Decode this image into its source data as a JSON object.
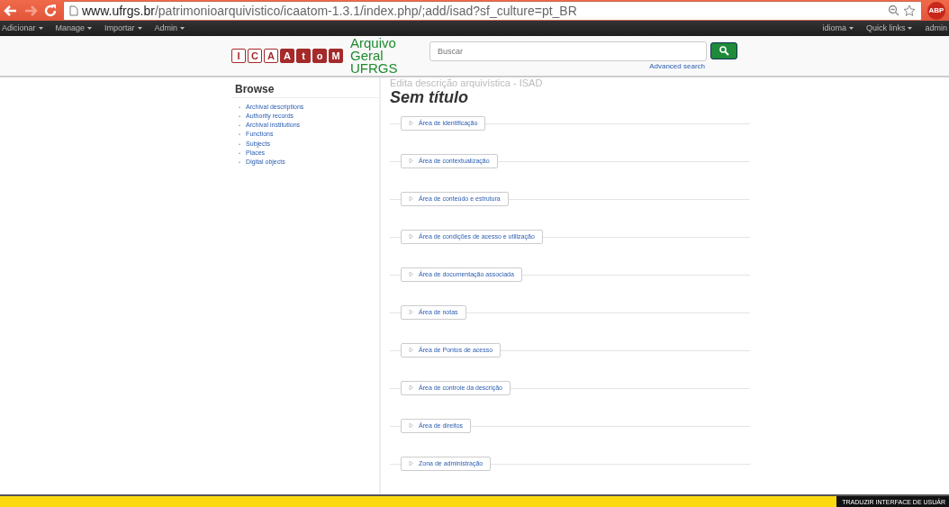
{
  "browser": {
    "url_host": "www.ufrgs.br",
    "url_path": "/patrimonioarquivistico/icaatom-1.3.1/index.php/;add/isad?sf_culture=pt_BR",
    "extension": "ABP"
  },
  "nav": {
    "left": [
      "Adicionar",
      "Manage",
      "Importar",
      "Admin"
    ],
    "right": [
      "idioma",
      "Quick links",
      "admin"
    ]
  },
  "header": {
    "logo_letters": [
      {
        "char": "I",
        "kind": "outline"
      },
      {
        "char": "C",
        "kind": "outline"
      },
      {
        "char": "A",
        "kind": "outline"
      },
      {
        "char": "A",
        "kind": "filled"
      },
      {
        "char": "t",
        "kind": "filled"
      },
      {
        "char": "o",
        "kind": "filled"
      },
      {
        "char": "M",
        "kind": "filled"
      }
    ],
    "site_name": [
      "Arquivo",
      "Geral",
      "UFRGS"
    ],
    "search": {
      "placeholder": "Buscar"
    },
    "advanced_search": "Advanced search"
  },
  "sidebar": {
    "title": "Browse",
    "marker": "•",
    "items": [
      "Archival descriptions",
      "Authority records",
      "Archival institutions",
      "Functions",
      "Subjects",
      "Places",
      "Digital objects"
    ]
  },
  "content": {
    "subtitle": "Edita descrição arquivística - ISAD",
    "title": "Sem título",
    "sections": [
      {
        "label": "Área de identificação",
        "expanded": false
      },
      {
        "label": "Área de contextualização",
        "expanded": false
      },
      {
        "label": "Área de conteúdo e estrutura",
        "expanded": false
      },
      {
        "label": "Área de condições de acesso e utilização",
        "expanded": false
      },
      {
        "label": "Área de documentação associada",
        "expanded": false
      },
      {
        "label": "Área de notas",
        "expanded": false
      },
      {
        "label": "Área de Pontos de acesso",
        "expanded": false
      },
      {
        "label": "Área de controle da descrição",
        "expanded": false
      },
      {
        "label": "Área de direitos",
        "expanded": false
      },
      {
        "label": "Zona de administração",
        "expanded": false
      }
    ]
  },
  "translate_bar": {
    "label": "TRADUZIR INTERFACE DE USUÁR"
  }
}
